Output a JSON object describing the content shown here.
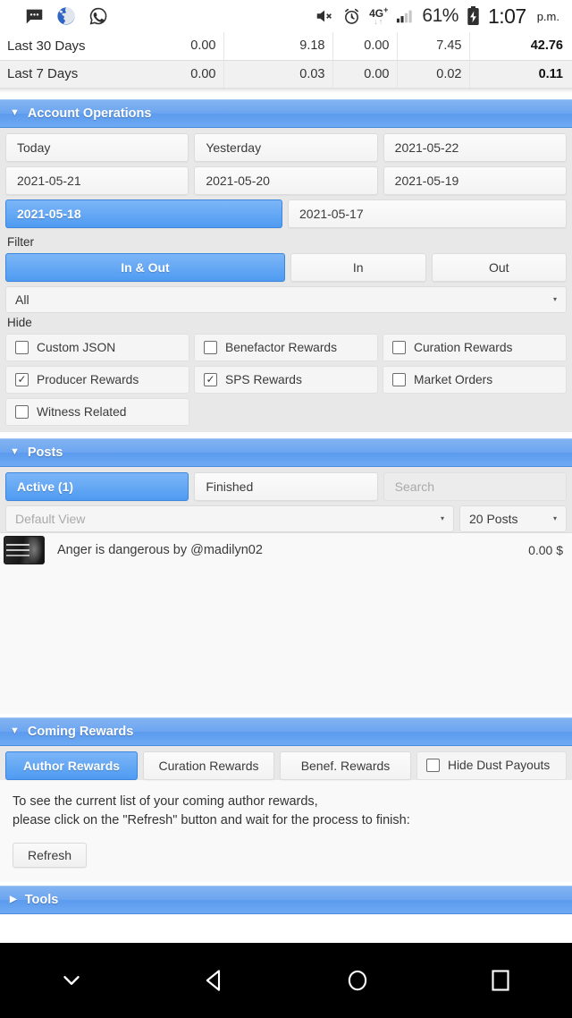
{
  "status_bar": {
    "left_icons": [
      "messages-icon",
      "browser-globe-icon",
      "whatsapp-icon"
    ],
    "mute_icon": "volume-mute-icon",
    "alarm_icon": "alarm-clock-icon",
    "network_type": "4G",
    "network_sup": "+",
    "signal_icon": "signal-bars-icon",
    "battery_percent": "61%",
    "battery_icon": "battery-charging-icon",
    "time": "1:07",
    "meridiem": "p.m."
  },
  "summary_table": {
    "rows": [
      {
        "label": "Last 30 Days",
        "c1": "0.00",
        "c2": "9.18",
        "c3": "0.00",
        "c4": "7.45",
        "total": "42.76"
      },
      {
        "label": "Last 7 Days",
        "c1": "0.00",
        "c2": "0.03",
        "c3": "0.00",
        "c4": "0.02",
        "total": "0.11"
      }
    ]
  },
  "account_operations": {
    "title": "Account Operations",
    "caret": "▼",
    "date_buttons": [
      [
        "Today",
        "Yesterday",
        "2021-05-22"
      ],
      [
        "2021-05-21",
        "2021-05-20",
        "2021-05-19"
      ],
      [
        "2021-05-18",
        "2021-05-17"
      ]
    ],
    "active_date": "2021-05-18",
    "filter_label": "Filter",
    "direction_tabs": [
      "In & Out",
      "In",
      "Out"
    ],
    "direction_active": "In & Out",
    "type_select": {
      "value": "All",
      "arrow": "▾"
    },
    "hide_label": "Hide",
    "hide_checkboxes": [
      [
        {
          "label": "Custom JSON",
          "checked": false
        },
        {
          "label": "Benefactor Rewards",
          "checked": false
        },
        {
          "label": "Curation Rewards",
          "checked": false
        }
      ],
      [
        {
          "label": "Producer Rewards",
          "checked": true
        },
        {
          "label": "SPS Rewards",
          "checked": true
        },
        {
          "label": "Market Orders",
          "checked": false
        }
      ],
      [
        {
          "label": "Witness Related",
          "checked": false
        }
      ]
    ],
    "check_glyph": "✓"
  },
  "posts": {
    "title": "Posts",
    "caret": "▼",
    "tabs": [
      {
        "label": "Active (1)",
        "active": true
      },
      {
        "label": "Finished",
        "active": false
      }
    ],
    "search_placeholder": "Search",
    "view_select": {
      "value": "Default View",
      "arrow": "▾"
    },
    "count_select": {
      "value": "20 Posts",
      "arrow": "▾"
    },
    "items": [
      {
        "thumbnail": "post-thumbnail",
        "title": "Anger is dangerous by @madilyn02",
        "value": "0.00 $"
      }
    ]
  },
  "coming_rewards": {
    "title": "Coming Rewards",
    "caret": "▼",
    "tabs": [
      {
        "label": "Author Rewards",
        "active": true
      },
      {
        "label": "Curation Rewards",
        "active": false
      },
      {
        "label": "Benef. Rewards",
        "active": false
      }
    ],
    "hide_dust": {
      "label": "Hide Dust Payouts",
      "checked": false
    },
    "line1": "To see the current list of your coming author rewards,",
    "line2": "please click on the \"Refresh\" button and wait for the process to finish:",
    "refresh_label": "Refresh"
  },
  "tools": {
    "title": "Tools",
    "caret": "▶"
  },
  "nav_bar": {
    "buttons": [
      "keyboard-hide-icon",
      "back-icon",
      "home-icon",
      "recents-icon"
    ]
  },
  "colors": {
    "accent_blue": "#4f9bf2",
    "header_blue": "#6ba4ef",
    "panel_gray": "#e8e8e8",
    "content_bg": "#f9f9f9"
  }
}
